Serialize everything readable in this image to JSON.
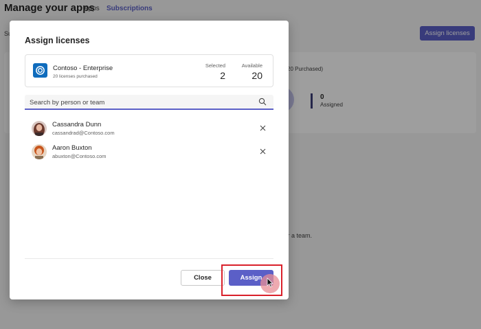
{
  "background": {
    "page_title": "Manage your apps",
    "nav": [
      "Apps",
      "Subscriptions"
    ],
    "sub_label": "Su",
    "assign_button": "Assign licenses",
    "purchased_text": "20 Purchased)",
    "assigned_count": "0",
    "assigned_label": "Assigned",
    "team_text": "le or a team."
  },
  "dialog": {
    "title": "Assign licenses",
    "product": {
      "name": "Contoso - Enterprise",
      "subtitle": "20 licenses purchased",
      "selected_label": "Selected",
      "selected_value": "2",
      "available_label": "Available",
      "available_value": "20",
      "icon": "contoso-logo-icon"
    },
    "search": {
      "placeholder": "Search by person or team"
    },
    "people": [
      {
        "name": "Cassandra Dunn",
        "email": "cassandrad@Contoso.com"
      },
      {
        "name": "Aaron Buxton",
        "email": "abuxton@Contoso.com"
      }
    ],
    "close_label": "Close",
    "assign_label": "Assign"
  },
  "colors": {
    "accent": "#5b5fc7",
    "highlight": "#d9202a",
    "product_logo": "#0f6cbd"
  }
}
